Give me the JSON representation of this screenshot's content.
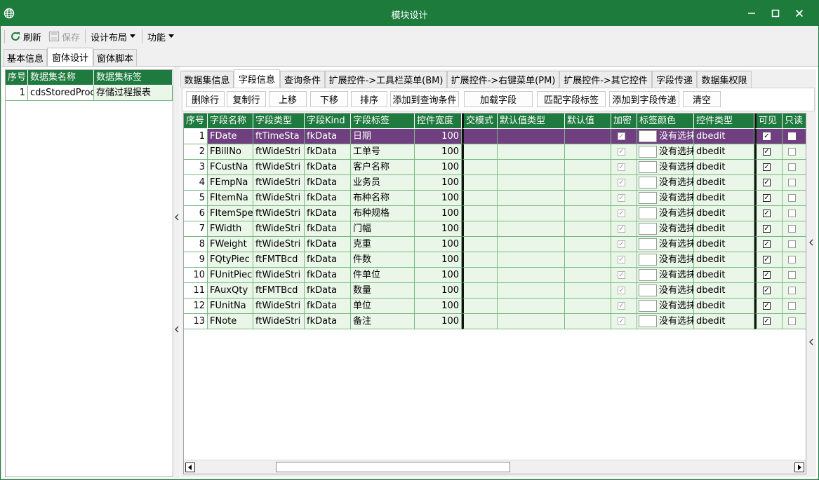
{
  "window": {
    "title": "模块设计"
  },
  "toolbar": {
    "refresh": "刷新",
    "save": "保存",
    "layout": "设计布局",
    "function": "功能"
  },
  "top_tabs": [
    "基本信息",
    "窗体设计",
    "窗体脚本"
  ],
  "active_top_tab": 1,
  "left_table": {
    "headers": [
      "序号",
      "数据集名称",
      "数据集标签"
    ],
    "rows": [
      [
        "1",
        "cdsStoredProc",
        "存储过程报表"
      ]
    ]
  },
  "sub_tabs": [
    "数据集信息",
    "字段信息",
    "查询条件",
    "扩展控件->工具栏菜单(BM)",
    "扩展控件->右键菜单(PM)",
    "扩展控件->其它控件",
    "字段传递",
    "数据集权限"
  ],
  "active_sub_tab": 1,
  "action_buttons": [
    "删除行",
    "复制行",
    "上移",
    "下移",
    "排序",
    "添加到查询条件",
    "加载字段",
    "匹配字段标签",
    "添加到字段传递",
    "清空"
  ],
  "grid": {
    "headers": [
      "序号",
      "字段名称",
      "字段类型",
      "字段Kind",
      "字段标签",
      "控件宽度",
      "交模式",
      "默认值类型",
      "默认值",
      "加密",
      "标签颜色",
      "控件类型",
      "可见",
      "只读"
    ],
    "rows": [
      {
        "no": "1",
        "name": "FDate",
        "type": "ftTimeSta",
        "kind": "fkData",
        "label": "日期",
        "width": "100",
        "color_text": "没有选抹",
        "ctrl": "dbedit",
        "visible": true,
        "readonly": false,
        "selected": true
      },
      {
        "no": "2",
        "name": "FBillNo",
        "type": "ftWideStri",
        "kind": "fkData",
        "label": "工单号",
        "width": "100",
        "color_text": "没有选抹",
        "ctrl": "dbedit",
        "visible": true,
        "readonly": false
      },
      {
        "no": "3",
        "name": "FCustNa",
        "type": "ftWideStri",
        "kind": "fkData",
        "label": "客户名称",
        "width": "100",
        "color_text": "没有选抹",
        "ctrl": "dbedit",
        "visible": true,
        "readonly": false
      },
      {
        "no": "4",
        "name": "FEmpNa",
        "type": "ftWideStri",
        "kind": "fkData",
        "label": "业务员",
        "width": "100",
        "color_text": "没有选抹",
        "ctrl": "dbedit",
        "visible": true,
        "readonly": false
      },
      {
        "no": "5",
        "name": "FItemNa",
        "type": "ftWideStri",
        "kind": "fkData",
        "label": "布种名称",
        "width": "100",
        "color_text": "没有选抹",
        "ctrl": "dbedit",
        "visible": true,
        "readonly": false
      },
      {
        "no": "6",
        "name": "FItemSpe",
        "type": "ftWideStri",
        "kind": "fkData",
        "label": "布种规格",
        "width": "100",
        "color_text": "没有选抹",
        "ctrl": "dbedit",
        "visible": true,
        "readonly": false
      },
      {
        "no": "7",
        "name": "FWidth",
        "type": "ftWideStri",
        "kind": "fkData",
        "label": "门幅",
        "width": "100",
        "color_text": "没有选抹",
        "ctrl": "dbedit",
        "visible": true,
        "readonly": false
      },
      {
        "no": "8",
        "name": "FWeight",
        "type": "ftWideStri",
        "kind": "fkData",
        "label": "克重",
        "width": "100",
        "color_text": "没有选抹",
        "ctrl": "dbedit",
        "visible": true,
        "readonly": false
      },
      {
        "no": "9",
        "name": "FQtyPiec",
        "type": "ftFMTBcd",
        "kind": "fkData",
        "label": "件数",
        "width": "100",
        "color_text": "没有选抹",
        "ctrl": "dbedit",
        "visible": true,
        "readonly": false
      },
      {
        "no": "10",
        "name": "FUnitPiec",
        "type": "ftWideStri",
        "kind": "fkData",
        "label": "件单位",
        "width": "100",
        "color_text": "没有选抹",
        "ctrl": "dbedit",
        "visible": true,
        "readonly": false
      },
      {
        "no": "11",
        "name": "FAuxQty",
        "type": "ftFMTBcd",
        "kind": "fkData",
        "label": "数量",
        "width": "100",
        "color_text": "没有选抹",
        "ctrl": "dbedit",
        "visible": true,
        "readonly": false
      },
      {
        "no": "12",
        "name": "FUnitNa",
        "type": "ftWideStri",
        "kind": "fkData",
        "label": "单位",
        "width": "100",
        "color_text": "没有选抹",
        "ctrl": "dbedit",
        "visible": true,
        "readonly": false
      },
      {
        "no": "13",
        "name": "FNote",
        "type": "ftWideStri",
        "kind": "fkData",
        "label": "备注",
        "width": "100",
        "color_text": "没有选抹",
        "ctrl": "dbedit",
        "visible": true,
        "readonly": false
      }
    ]
  },
  "colors": {
    "accent": "#1d7b3c",
    "selected_row": "#6f3f7f",
    "row_bg": "#eaf6e8",
    "grid_line": "#79b985"
  }
}
